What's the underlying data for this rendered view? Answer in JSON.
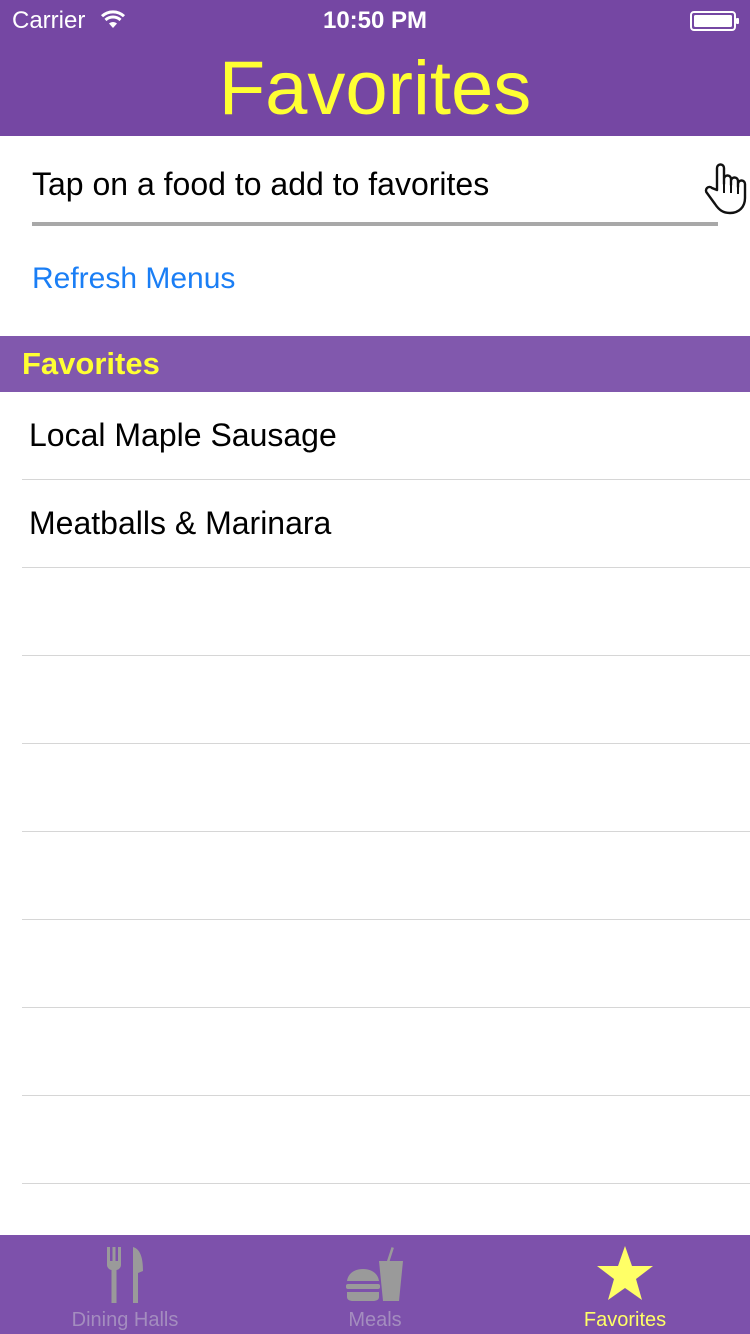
{
  "status_bar": {
    "carrier": "Carrier",
    "time": "10:50 PM"
  },
  "nav": {
    "title": "Favorites"
  },
  "search": {
    "prompt": "Tap on a food to add to favorites",
    "icon": "hand-pointer-icon"
  },
  "refresh": {
    "label": "Refresh Menus"
  },
  "section": {
    "title": "Favorites"
  },
  "favorites": [
    {
      "label": "Local Maple Sausage"
    },
    {
      "label": "Meatballs & Marinara"
    },
    {
      "label": ""
    },
    {
      "label": ""
    },
    {
      "label": ""
    },
    {
      "label": ""
    },
    {
      "label": ""
    },
    {
      "label": ""
    },
    {
      "label": ""
    }
  ],
  "tabs": [
    {
      "label": "Dining Halls",
      "icon": "fork-knife-icon",
      "active": false
    },
    {
      "label": "Meals",
      "icon": "burger-drink-icon",
      "active": false
    },
    {
      "label": "Favorites",
      "icon": "star-icon",
      "active": true
    }
  ],
  "colors": {
    "brand_purple": "#7547a3",
    "title_yellow": "#ffff33",
    "link_blue": "#1a7ef5"
  }
}
